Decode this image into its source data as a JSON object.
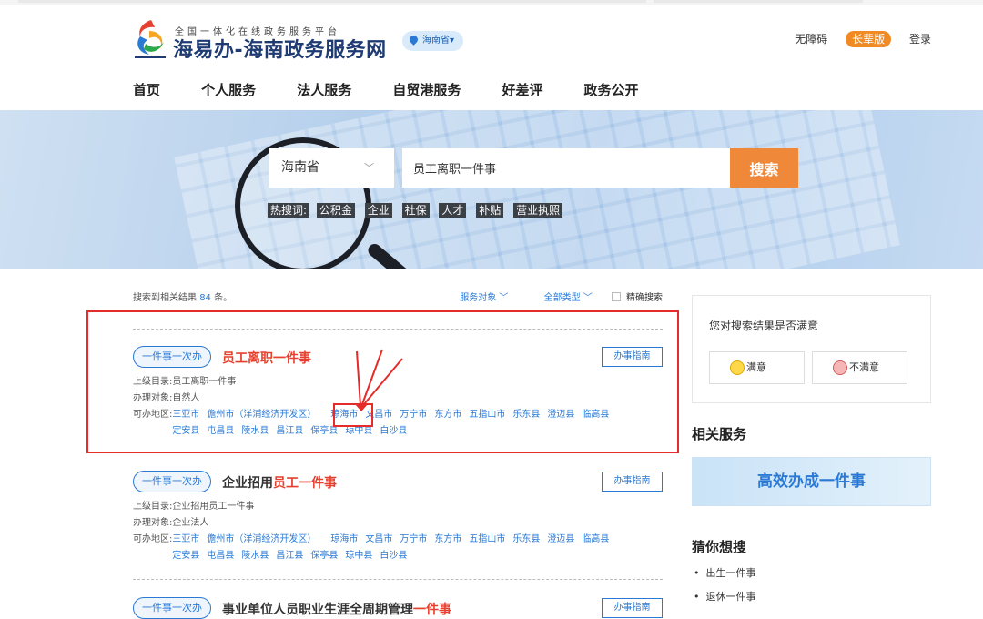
{
  "header": {
    "tagline": "全国一体化在线政务服务平台",
    "site_name": "海易办-海南政务服务网",
    "location": "海南省",
    "accessibility": "无障碍",
    "elder_mode": "长辈版",
    "login": "登录"
  },
  "nav": [
    "首页",
    "个人服务",
    "法人服务",
    "自贸港服务",
    "好差评",
    "政务公开"
  ],
  "search": {
    "region": "海南省",
    "query": "员工离职一件事",
    "button": "搜索",
    "hot_label": "热搜词:",
    "hot_words": [
      "公积金",
      "企业",
      "社保",
      "人才",
      "补贴",
      "营业执照"
    ]
  },
  "results": {
    "prefix": "搜索到相关结果",
    "count": "84",
    "suffix": "条。",
    "filter_target": "服务对象",
    "filter_type": "全部类型",
    "exact": "精确搜索",
    "label_parent": "上级目录:",
    "label_target": "办理对象:",
    "label_area": "可办地区:",
    "items": [
      {
        "tag": "一件事一次办",
        "title_pre": "",
        "title_hl": "员工离职一件事",
        "guide": "办事指南",
        "parent": "员工离职一件事",
        "target": "自然人",
        "areas": [
          "三亚市",
          "儋州市（洋浦经济开发区）",
          "琼海市",
          "文昌市",
          "万宁市",
          "东方市",
          "五指山市",
          "乐东县",
          "澄迈县",
          "临高县",
          "定安县",
          "屯昌县",
          "陵水县",
          "昌江县",
          "保亭县",
          "琼中县",
          "白沙县"
        ]
      },
      {
        "tag": "一件事一次办",
        "title_pre": "企业招用",
        "title_hl": "员工一件事",
        "guide": "办事指南",
        "parent": "企业招用员工一件事",
        "target": "企业法人",
        "areas": [
          "三亚市",
          "儋州市（洋浦经济开发区）",
          "琼海市",
          "文昌市",
          "万宁市",
          "东方市",
          "五指山市",
          "乐东县",
          "澄迈县",
          "临高县",
          "定安县",
          "屯昌县",
          "陵水县",
          "昌江县",
          "保亭县",
          "琼中县",
          "白沙县"
        ]
      },
      {
        "tag": "一件事一次办",
        "title_pre": "事业单位人员职业生涯全周期管理",
        "title_hl": "一件事",
        "guide": "办事指南"
      }
    ]
  },
  "sidebar": {
    "feedback_question": "您对搜索结果是否满意",
    "satisfied": "满意",
    "unsatisfied": "不满意",
    "related_title": "相关服务",
    "promo": "高效办成一件事",
    "guess_title": "猜你想搜",
    "guess": [
      "出生一件事",
      "退休一件事"
    ]
  }
}
